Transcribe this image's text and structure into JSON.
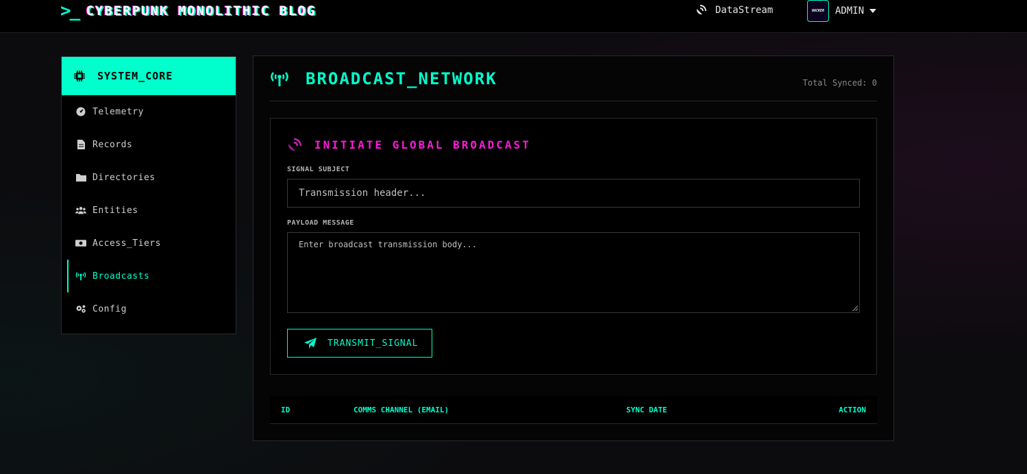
{
  "header": {
    "prompt": ">_",
    "brand": "CYBERPUNK MONOLITHIC BLOG",
    "datastream_label": "DataStream",
    "avatar_text": "HACKER",
    "user_label": "ADMIN"
  },
  "sidebar": {
    "title": "SYSTEM_CORE",
    "items": [
      {
        "label": "Telemetry",
        "icon": "dashboard-gauge-icon"
      },
      {
        "label": "Records",
        "icon": "file-icon"
      },
      {
        "label": "Directories",
        "icon": "folder-icon"
      },
      {
        "label": "Entities",
        "icon": "users-icon"
      },
      {
        "label": "Access_Tiers",
        "icon": "money-icon"
      },
      {
        "label": "Broadcasts",
        "icon": "broadcast-tower-icon",
        "active": true
      },
      {
        "label": "Config",
        "icon": "cogs-icon"
      }
    ]
  },
  "panel": {
    "title": "BROADCAST_NETWORK",
    "total_synced": "Total Synced: 0"
  },
  "broadcast": {
    "title": "INITIATE GLOBAL BROADCAST",
    "subject_label": "SIGNAL SUBJECT",
    "subject_placeholder": "Transmission header...",
    "payload_label": "PAYLOAD MESSAGE",
    "payload_placeholder": "Enter broadcast transmission body...",
    "transmit_label": "TRANSMIT_SIGNAL"
  },
  "table": {
    "columns": [
      "ID",
      "COMMS CHANNEL (EMAIL)",
      "SYNC DATE",
      "ACTION"
    ]
  },
  "colors": {
    "accent": "#00ffcc",
    "magenta": "#ff1ad9",
    "background": "#0c0b0e"
  }
}
